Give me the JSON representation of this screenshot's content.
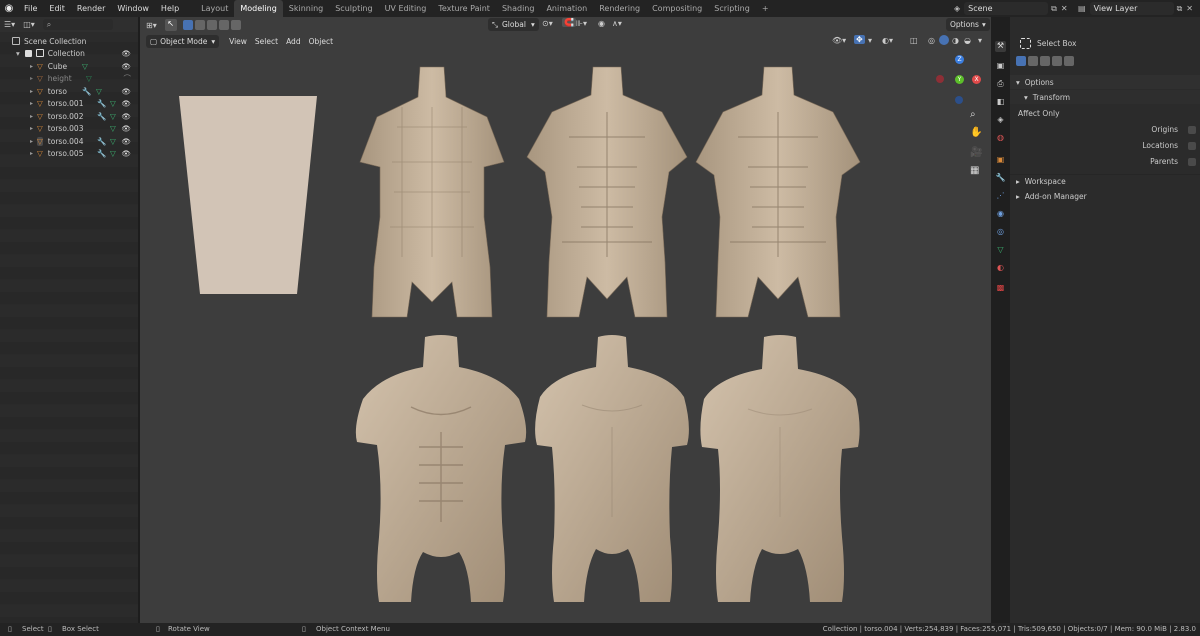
{
  "topbar": {
    "menus": [
      "File",
      "Edit",
      "Render",
      "Window",
      "Help"
    ],
    "workspaces": [
      "Layout",
      "Modeling",
      "Skinning",
      "Sculpting",
      "UV Editing",
      "Texture Paint",
      "Shading",
      "Animation",
      "Rendering",
      "Compositing",
      "Scripting"
    ],
    "active_workspace": "Modeling",
    "scene": "Scene",
    "view_layer": "View Layer",
    "add_tab": "+"
  },
  "outliner": {
    "root": "Scene Collection",
    "collection": "Collection",
    "items": [
      {
        "name": "Cube",
        "color": "#d98a3a"
      },
      {
        "name": "height",
        "color": "#888888"
      },
      {
        "name": "torso",
        "color": "#d98a3a"
      },
      {
        "name": "torso.001",
        "color": "#d98a3a"
      },
      {
        "name": "torso.002",
        "color": "#d98a3a"
      },
      {
        "name": "torso.003",
        "color": "#d98a3a"
      },
      {
        "name": "torso.004",
        "color": "#d98a3a"
      },
      {
        "name": "torso.005",
        "color": "#d98a3a"
      }
    ]
  },
  "viewport": {
    "mode": "Object Mode",
    "menus": [
      "View",
      "Select",
      "Add",
      "Object"
    ],
    "orientation": "Global",
    "options": "Options",
    "gizmo": {
      "z": "Z",
      "y": "Y",
      "x": "X"
    }
  },
  "properties": {
    "tool": "Select Box",
    "options_header": "Options",
    "transform_header": "Transform",
    "affect_only": "Affect Only",
    "checks": [
      "Origins",
      "Locations",
      "Parents"
    ],
    "workspace": "Workspace",
    "addon": "Add-on Manager"
  },
  "status": {
    "select": "Select",
    "box_select": "Box Select",
    "rotate": "Rotate View",
    "context": "Object Context Menu",
    "stats": "Collection | torso.004 | Verts:254,839 | Faces:255,071 | Tris:509,650 | Objects:0/7 | Mem: 90.0 MiB | 2.83.0"
  },
  "colors": {
    "accent": "#4772b3",
    "skin": "#b9a791",
    "object_orange": "#d98a3a",
    "mesh_green": "#3cb371"
  }
}
